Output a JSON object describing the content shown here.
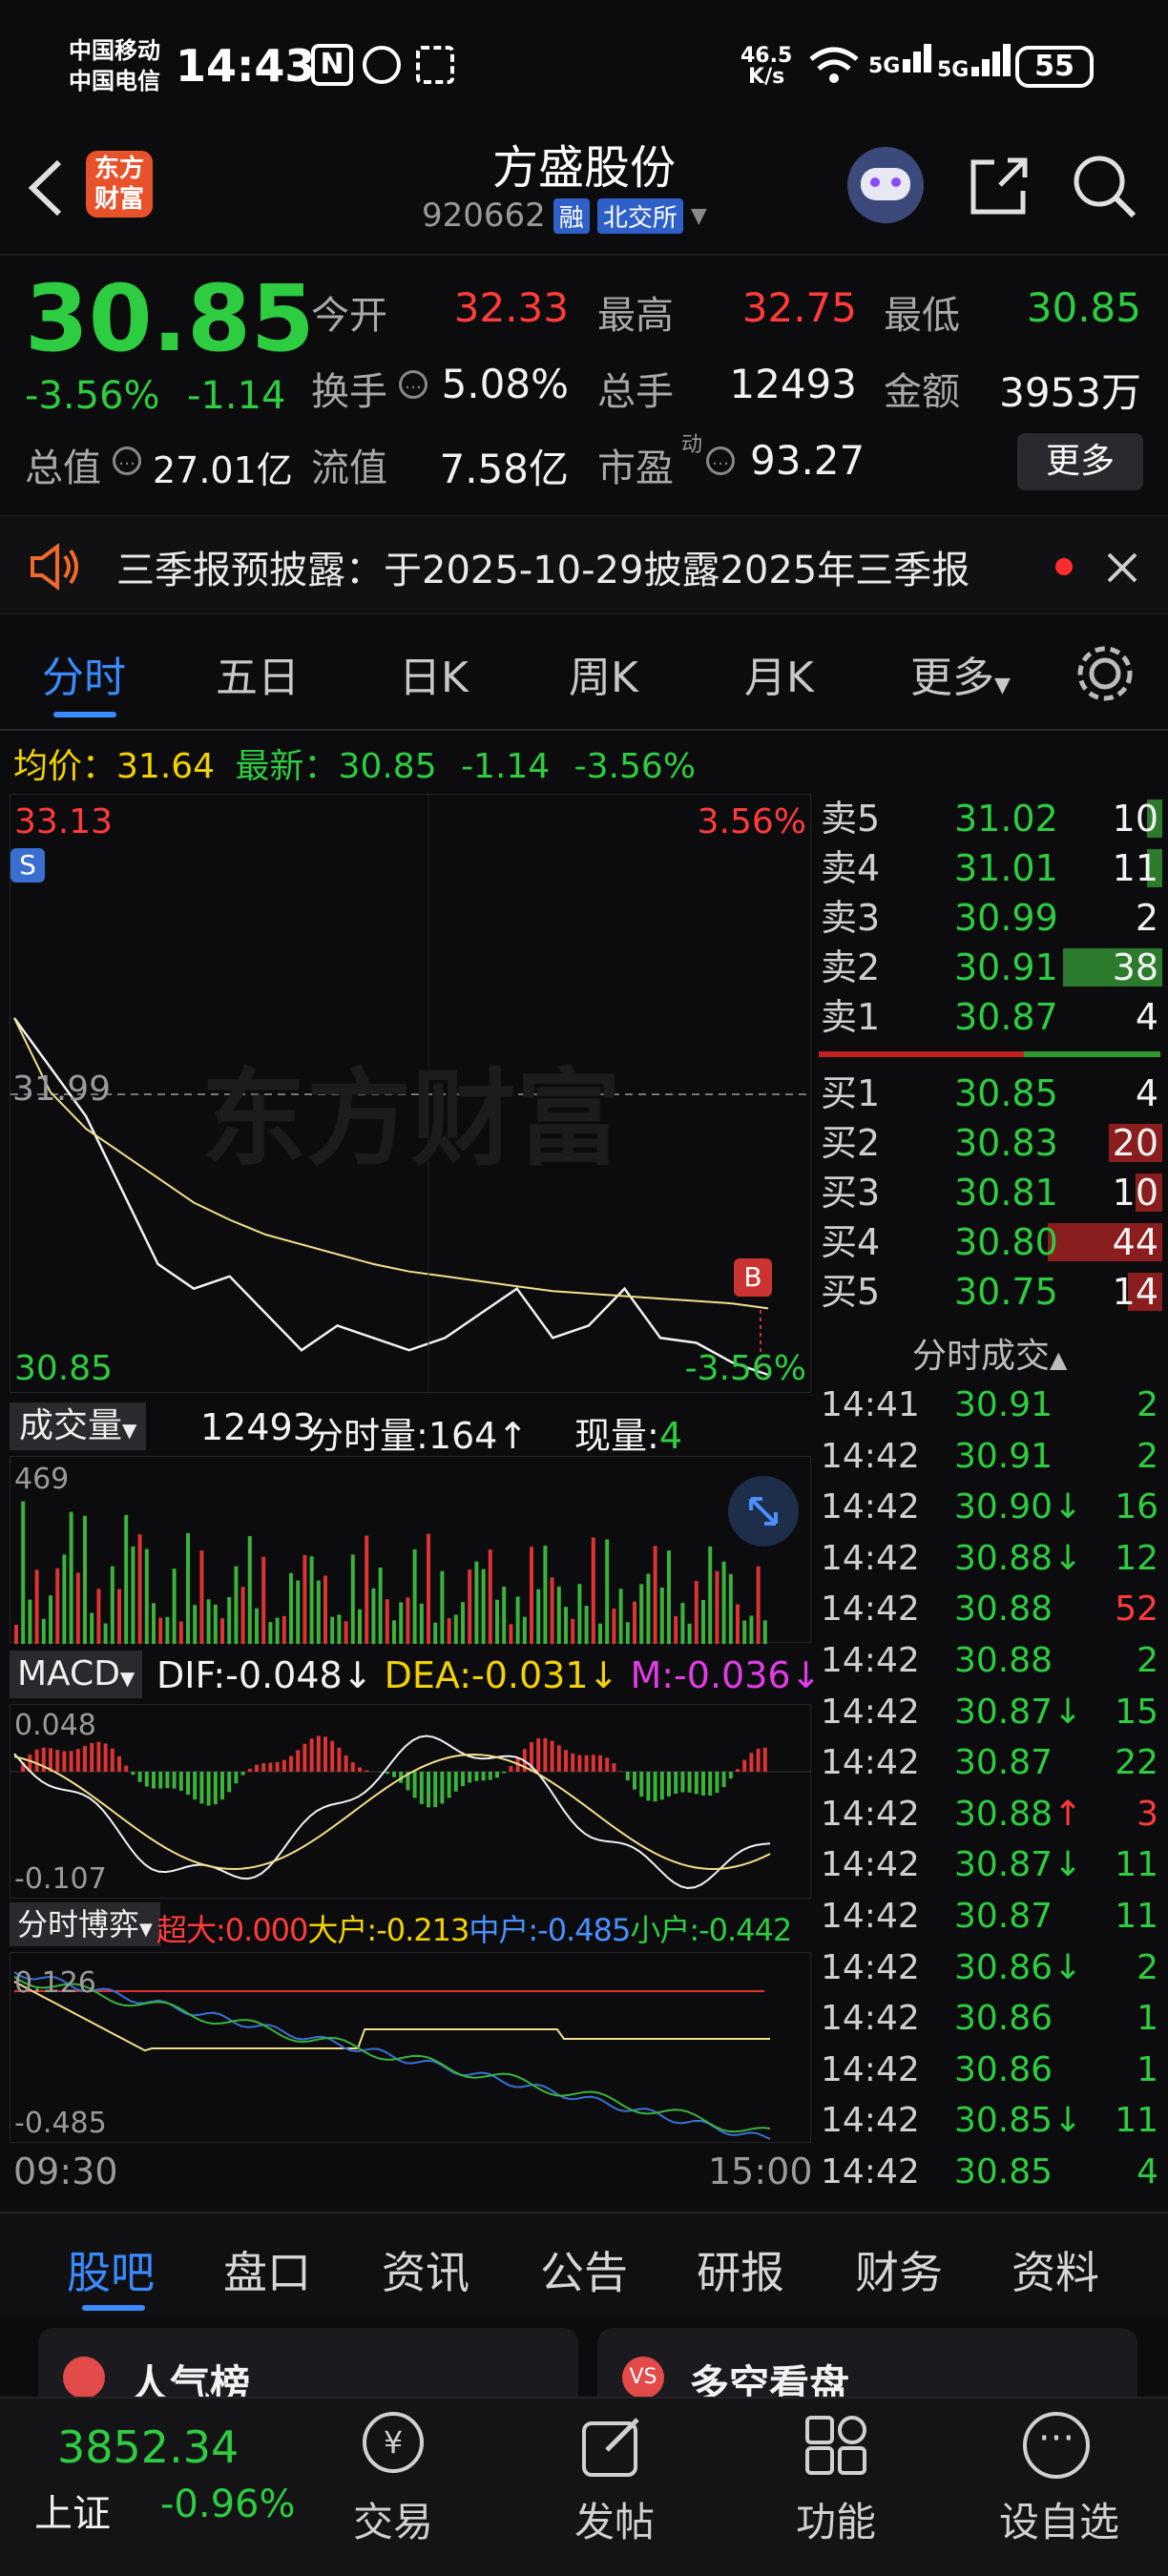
{
  "status_bar": {
    "carrier1": "中国移动",
    "carrier2": "中国电信",
    "time": "14:43",
    "net_speed_top": "46.5",
    "net_speed_bottom": "K/s",
    "battery": "55"
  },
  "header": {
    "logo_line1": "东方",
    "logo_line2": "财富",
    "title": "方盛股份",
    "code": "920662",
    "tag_margin": "融",
    "tag_exchange": "北交所"
  },
  "quote": {
    "price": "30.85",
    "change_pct": "-3.56%",
    "change": "-1.14",
    "open_label": "今开",
    "open": "32.33",
    "high_label": "最高",
    "high": "32.75",
    "low_label": "最低",
    "low": "30.85",
    "turnover_label": "换手",
    "turnover": "5.08%",
    "volume_label": "总手",
    "volume": "12493",
    "amount_label": "金额",
    "amount": "3953万",
    "mktcap_label": "总值",
    "mktcap": "27.01亿",
    "float_label": "流值",
    "float": "7.58亿",
    "pe_label": "市盈",
    "pe_sup": "动",
    "pe": "93.27",
    "more": "更多"
  },
  "notice": {
    "text": "三季报预披露：于2025-10-29披露2025年三季报"
  },
  "tabs": [
    "分时",
    "五日",
    "日K",
    "周K",
    "月K",
    "更多"
  ],
  "intraday": {
    "avg_label": "均价：",
    "avg": "31.64",
    "latest_label": "最新：",
    "latest": "30.85",
    "chg": "-1.14",
    "chg_pct": "-3.56%",
    "y_max": "33.13",
    "y_min": "30.85",
    "pct_max": "3.56%",
    "pct_min": "-3.56%",
    "y_mid": "31.99",
    "watermark": "东方财富",
    "marker_s": "S",
    "marker_b": "B",
    "time_start": "09:30",
    "time_end": "15:00"
  },
  "volume_bar": {
    "label": "成交量",
    "total": "12493",
    "minute_label": "分时量:",
    "minute": "164",
    "now_label": "现量:",
    "now": "4",
    "ymax": "469"
  },
  "macd": {
    "label": "MACD",
    "dif": "DIF:-0.048",
    "dea": "DEA:-0.031",
    "m": "M:-0.036",
    "ymax": "0.048",
    "ymin": "-0.107"
  },
  "flow": {
    "label": "分时博弈",
    "super": "超大:0.000",
    "big": "大户:-0.213",
    "mid": "中户:-0.485",
    "small": "小户:-0.442",
    "ymax": "0.126",
    "ymin": "-0.485"
  },
  "orderbook": {
    "asks": [
      {
        "label": "卖5",
        "price": "31.02",
        "qty": "10",
        "bar": 0.08
      },
      {
        "label": "卖4",
        "price": "31.01",
        "qty": "11",
        "bar": 0.08
      },
      {
        "label": "卖3",
        "price": "30.99",
        "qty": "2",
        "bar": 0
      },
      {
        "label": "卖2",
        "price": "30.91",
        "qty": "38",
        "bar": 0.52
      },
      {
        "label": "卖1",
        "price": "30.87",
        "qty": "4",
        "bar": 0
      }
    ],
    "bids": [
      {
        "label": "买1",
        "price": "30.85",
        "qty": "4",
        "bar": 0
      },
      {
        "label": "买2",
        "price": "30.83",
        "qty": "20",
        "bar": 0.28
      },
      {
        "label": "买3",
        "price": "30.81",
        "qty": "10",
        "bar": 0.14
      },
      {
        "label": "买4",
        "price": "30.80",
        "qty": "44",
        "bar": 0.6
      },
      {
        "label": "买5",
        "price": "30.75",
        "qty": "14",
        "bar": 0.18
      }
    ],
    "trades_title": "分时成交"
  },
  "trades": [
    {
      "time": "14:41",
      "price": "30.91",
      "arrow": "",
      "qty": "2",
      "dir": "g"
    },
    {
      "time": "14:42",
      "price": "30.91",
      "arrow": "",
      "qty": "2",
      "dir": "g"
    },
    {
      "time": "14:42",
      "price": "30.90",
      "arrow": "↓",
      "qty": "16",
      "dir": "g"
    },
    {
      "time": "14:42",
      "price": "30.88",
      "arrow": "↓",
      "qty": "12",
      "dir": "g"
    },
    {
      "time": "14:42",
      "price": "30.88",
      "arrow": "",
      "qty": "52",
      "dir": "r"
    },
    {
      "time": "14:42",
      "price": "30.88",
      "arrow": "",
      "qty": "2",
      "dir": "g"
    },
    {
      "time": "14:42",
      "price": "30.87",
      "arrow": "↓",
      "qty": "15",
      "dir": "g"
    },
    {
      "time": "14:42",
      "price": "30.87",
      "arrow": "",
      "qty": "22",
      "dir": "g"
    },
    {
      "time": "14:42",
      "price": "30.88",
      "arrow": "↑",
      "qty": "3",
      "dir": "r"
    },
    {
      "time": "14:42",
      "price": "30.87",
      "arrow": "↓",
      "qty": "11",
      "dir": "g"
    },
    {
      "time": "14:42",
      "price": "30.87",
      "arrow": "",
      "qty": "11",
      "dir": "g"
    },
    {
      "time": "14:42",
      "price": "30.86",
      "arrow": "↓",
      "qty": "2",
      "dir": "g"
    },
    {
      "time": "14:42",
      "price": "30.86",
      "arrow": "",
      "qty": "1",
      "dir": "g"
    },
    {
      "time": "14:42",
      "price": "30.86",
      "arrow": "",
      "qty": "1",
      "dir": "g"
    },
    {
      "time": "14:42",
      "price": "30.85",
      "arrow": "↓",
      "qty": "11",
      "dir": "g"
    },
    {
      "time": "14:42",
      "price": "30.85",
      "arrow": "",
      "qty": "4",
      "dir": "g"
    }
  ],
  "subtabs": [
    "股吧",
    "盘口",
    "资讯",
    "公告",
    "研报",
    "财务",
    "资料"
  ],
  "cards": {
    "left": "人气榜",
    "right": "多空看盘"
  },
  "bottom_nav": {
    "index_value": "3852.34",
    "index_name": "上证",
    "index_chg": "-0.96%",
    "items": [
      "交易",
      "发帖",
      "功能",
      "设自选"
    ]
  },
  "chart_data": {
    "type": "line",
    "x": [
      "09:30",
      "15:00"
    ],
    "ylim": [
      30.85,
      33.13
    ],
    "series": [
      {
        "values": [
          32.3,
          32.1,
          31.9,
          31.6,
          31.3,
          31.2,
          31.25,
          31.1,
          30.95,
          31.05,
          31.0,
          30.95,
          31.0,
          31.1,
          31.2,
          31.0,
          31.05,
          31.2,
          31.0,
          30.98,
          30.9,
          30.85
        ]
      },
      {
        "values": [
          32.3,
          32.0,
          31.85,
          31.75,
          31.65,
          31.55,
          31.48,
          31.42,
          31.38,
          31.34,
          31.3,
          31.27,
          31.25,
          31.23,
          31.21,
          31.19,
          31.18,
          31.17,
          31.16,
          31.15,
          31.14,
          31.12
        ]
      }
    ]
  }
}
